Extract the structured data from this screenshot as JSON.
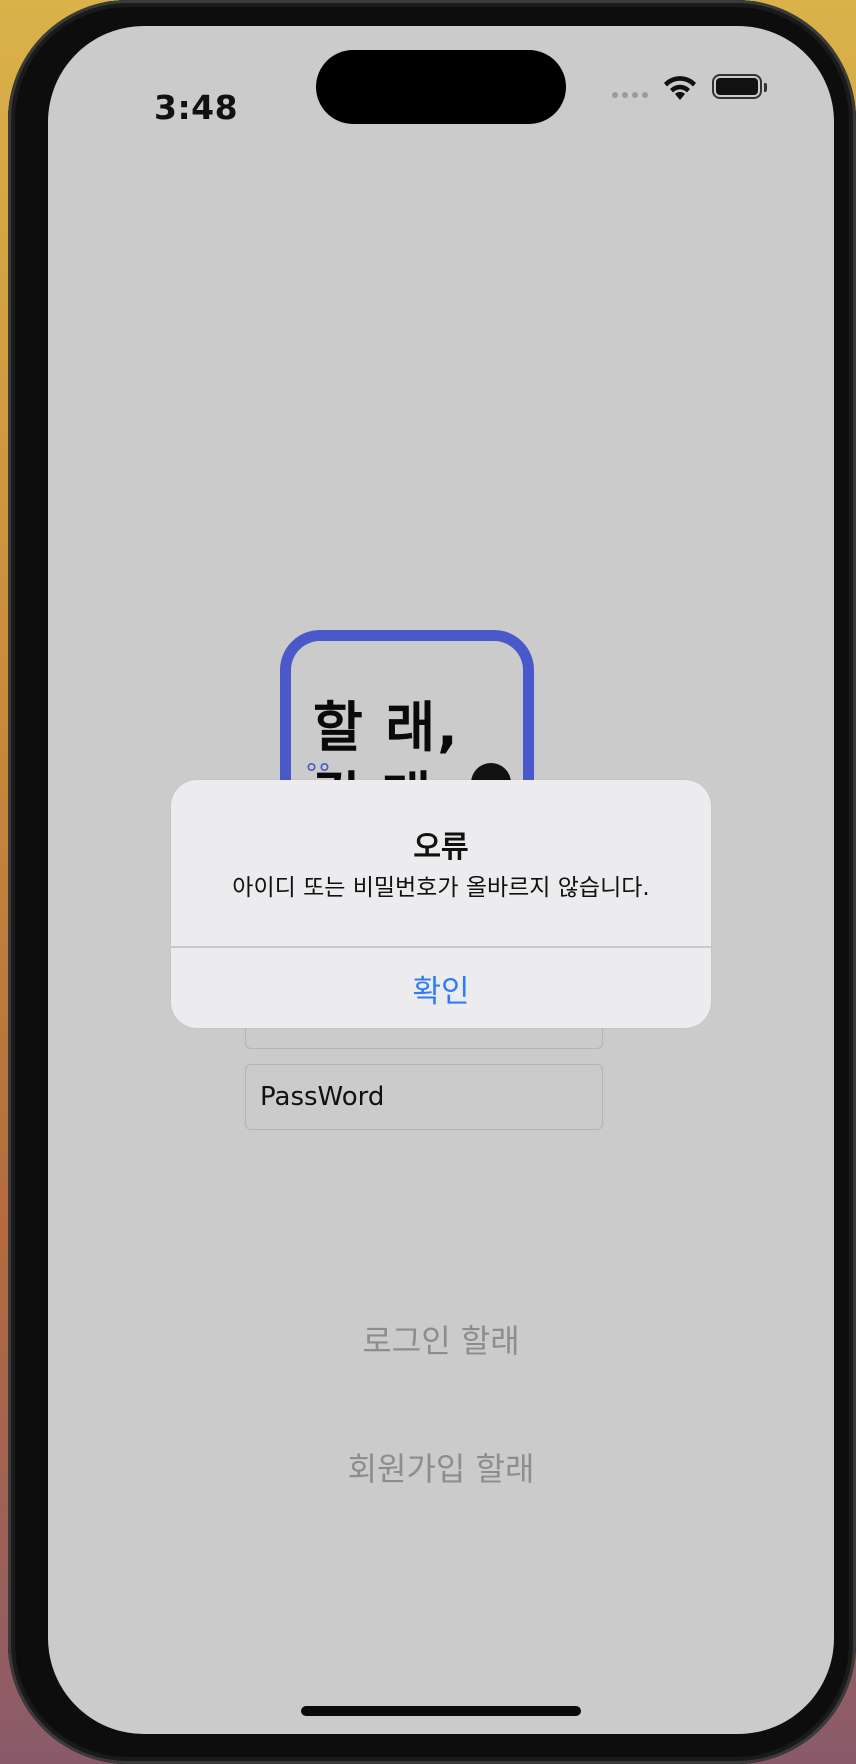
{
  "status_bar": {
    "time": "3:48",
    "icons": [
      "cellular-signal-icon",
      "wifi-icon",
      "battery-icon"
    ]
  },
  "logo": {
    "line1": "할 래,",
    "line2": "갈 래"
  },
  "form": {
    "id_field_value": "",
    "password_field_value": "PassWord"
  },
  "buttons": {
    "login": "로그인 할래",
    "signup": "회원가입 할래"
  },
  "alert": {
    "title": "오류",
    "message": "아이디 또는 비밀번호가 올바르지 않습니다.",
    "confirm_label": "확인"
  },
  "colors": {
    "accent": "#2f7cf6",
    "logo_border": "#4a59c9",
    "dimmed_background": "#cbcbcb"
  }
}
